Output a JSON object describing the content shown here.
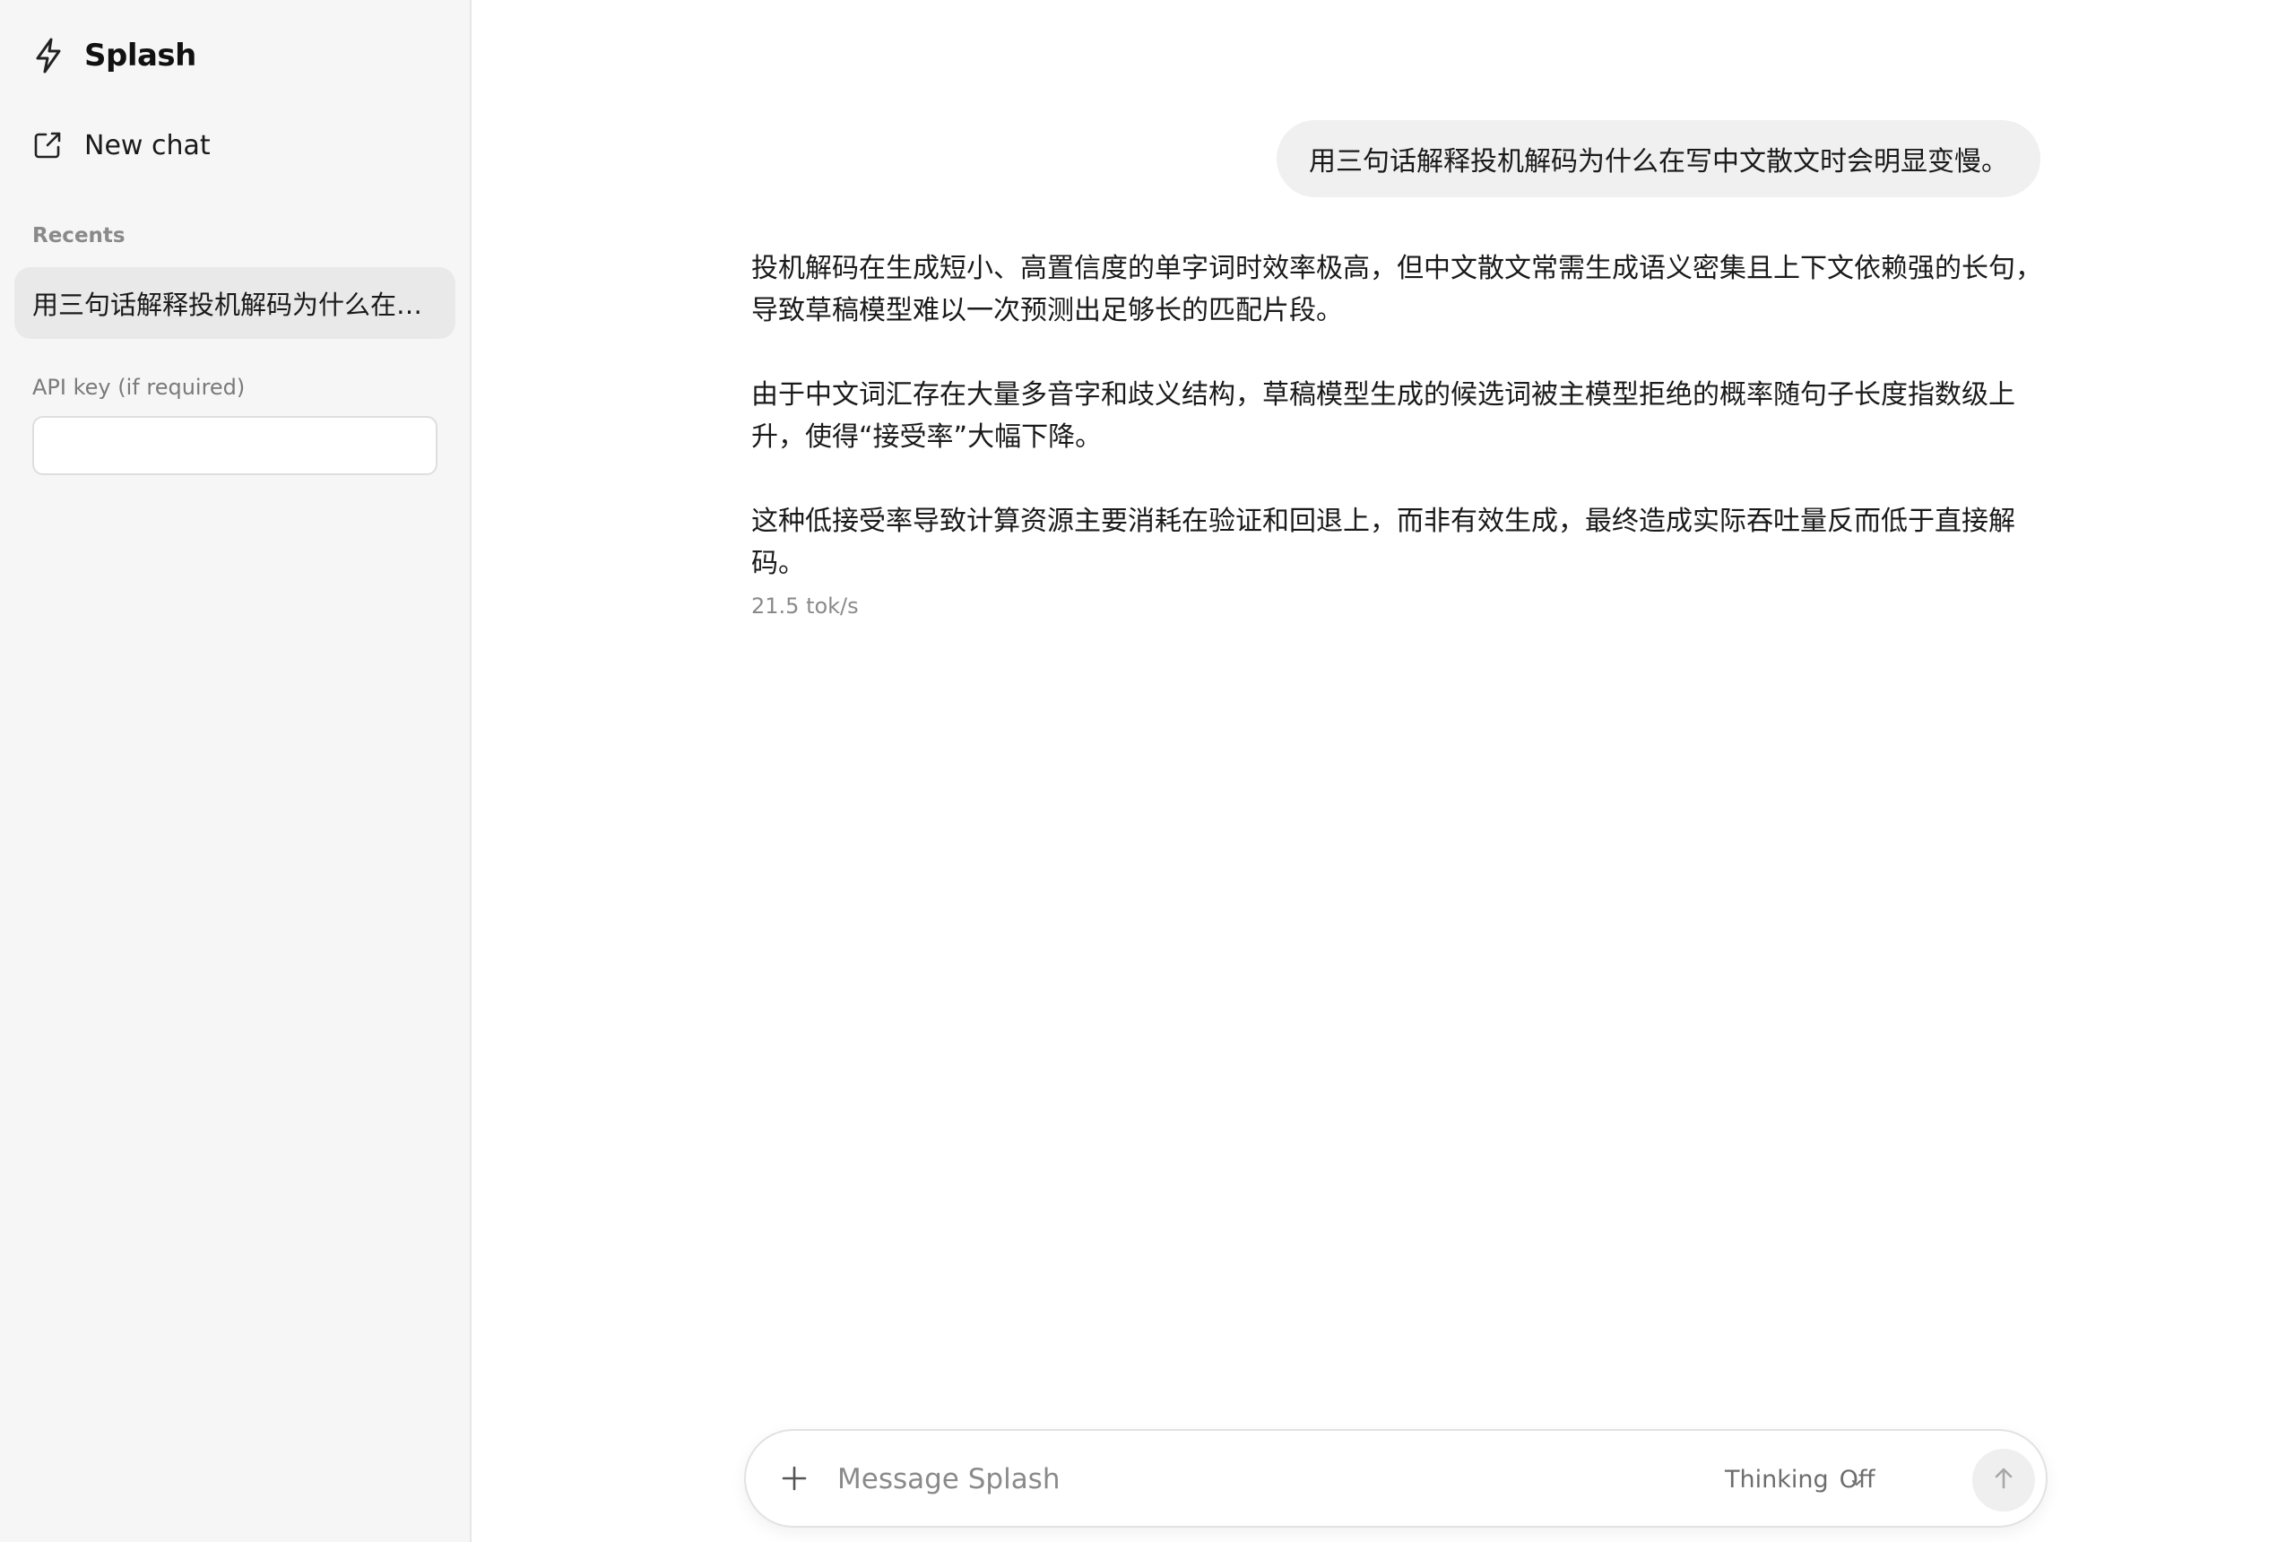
{
  "sidebar": {
    "brand_name": "Splash",
    "new_chat_label": "New chat",
    "recents_label": "Recents",
    "recents": [
      {
        "title": "用三句话解释投机解码为什么在写中文散文时会明显变慢。"
      }
    ],
    "api_key_label": "API key (if required)",
    "api_key_value": ""
  },
  "chat": {
    "user_message": "用三句话解释投机解码为什么在写中文散文时会明显变慢。",
    "assistant_paragraphs": [
      "投机解码在生成短小、高置信度的单字词时效率极高，但中文散文常需生成语义密集且上下文依赖强的长句，导致草稿模型难以一次预测出足够长的匹配片段。",
      "由于中文词汇存在大量多音字和歧义结构，草稿模型生成的候选词被主模型拒绝的概率随句子长度指数级上升，使得“接受率”大幅下降。",
      "这种低接受率导致计算资源主要消耗在验证和回退上，而非有效生成，最终造成实际吞吐量反而低于直接解码。"
    ],
    "token_rate": "21.5 tok/s"
  },
  "composer": {
    "placeholder": "Message Splash",
    "thinking_label": "Thinking",
    "thinking_value": "Off"
  },
  "icons": {
    "brand": "bolt-icon",
    "new_chat": "compose-icon",
    "attach": "plus-icon",
    "thinking_dropdown": "chevron-down-icon",
    "send": "arrow-up-icon"
  }
}
